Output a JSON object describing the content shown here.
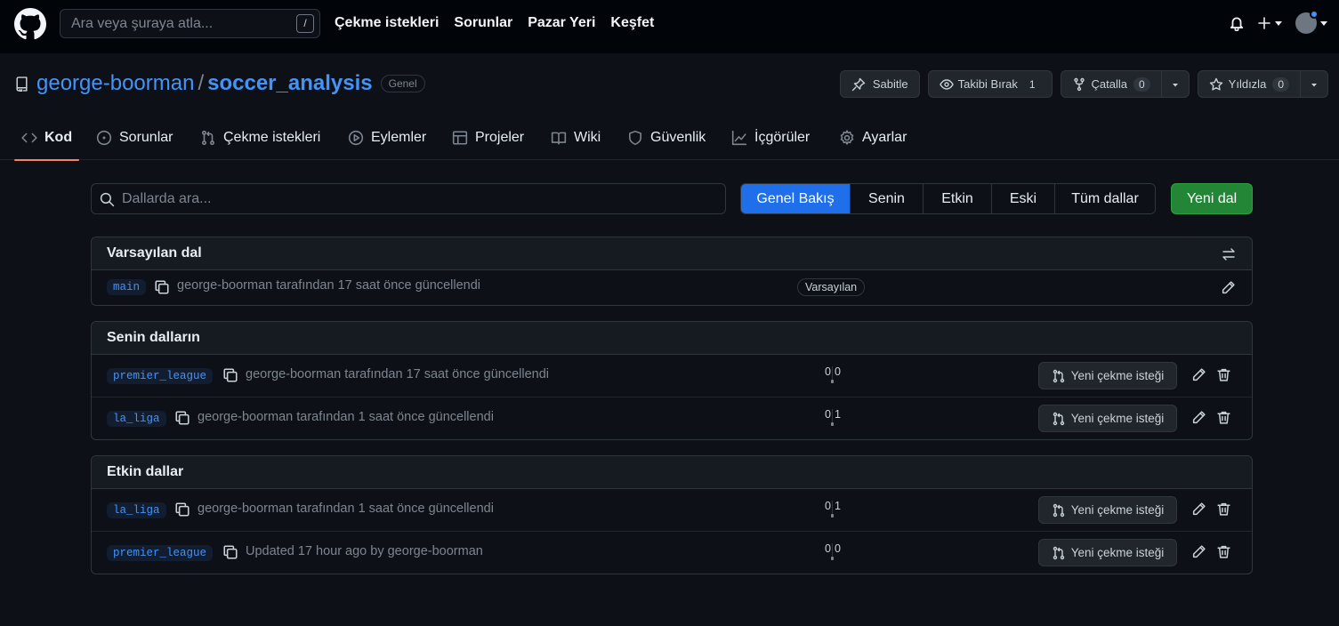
{
  "header": {
    "search_placeholder": "Ara veya şuraya atla...",
    "search_shortcut": "/",
    "nav": [
      "Çekme istekleri",
      "Sorunlar",
      "Pazar Yeri",
      "Keşfet"
    ]
  },
  "repo": {
    "owner": "george-boorman",
    "separator": "/",
    "name": "soccer_analysis",
    "visibility": "Genel",
    "actions": {
      "pin": "Sabitle",
      "unwatch": "Takibi Bırak",
      "unwatch_count": "1",
      "fork": "Çatalla",
      "fork_count": "0",
      "star": "Yıldızla",
      "star_count": "0"
    }
  },
  "tabs": [
    "Kod",
    "Sorunlar",
    "Çekme istekleri",
    "Eylemler",
    "Projeler",
    "Wiki",
    "Güvenlik",
    "İçgörüler",
    "Ayarlar"
  ],
  "branches_page": {
    "search_placeholder": "Dallarda ara...",
    "filters": [
      "Genel Bakış",
      "Senin",
      "Etkin",
      "Eski",
      "Tüm dallar"
    ],
    "new_branch": "Yeni dal",
    "new_pr_label": "Yeni çekme isteği",
    "default_badge": "Varsayılan",
    "sections": {
      "default": {
        "title": "Varsayılan dal",
        "rows": [
          {
            "name": "main",
            "meta": "george-boorman tarafından 17 saat önce güncellendi"
          }
        ]
      },
      "yours": {
        "title": "Senin dalların",
        "rows": [
          {
            "name": "premier_league",
            "meta": "george-boorman tarafından 17 saat önce güncellendi",
            "behind": "0",
            "ahead": "0"
          },
          {
            "name": "la_liga",
            "meta": "george-boorman tarafından 1 saat önce güncellendi",
            "behind": "0",
            "ahead": "1"
          }
        ]
      },
      "active": {
        "title": "Etkin dallar",
        "rows": [
          {
            "name": "la_liga",
            "meta": "george-boorman tarafından 1 saat önce güncellendi",
            "behind": "0",
            "ahead": "1"
          },
          {
            "name": "premier_league",
            "meta": "Updated 17 hour ago by george-boorman",
            "behind": "0",
            "ahead": "0"
          }
        ]
      }
    }
  },
  "colors": {
    "background": "#0d1117",
    "accent_blue": "#1f6feb",
    "link_blue": "#4493f8",
    "green_button": "#238636",
    "tab_underline": "#f78166"
  }
}
